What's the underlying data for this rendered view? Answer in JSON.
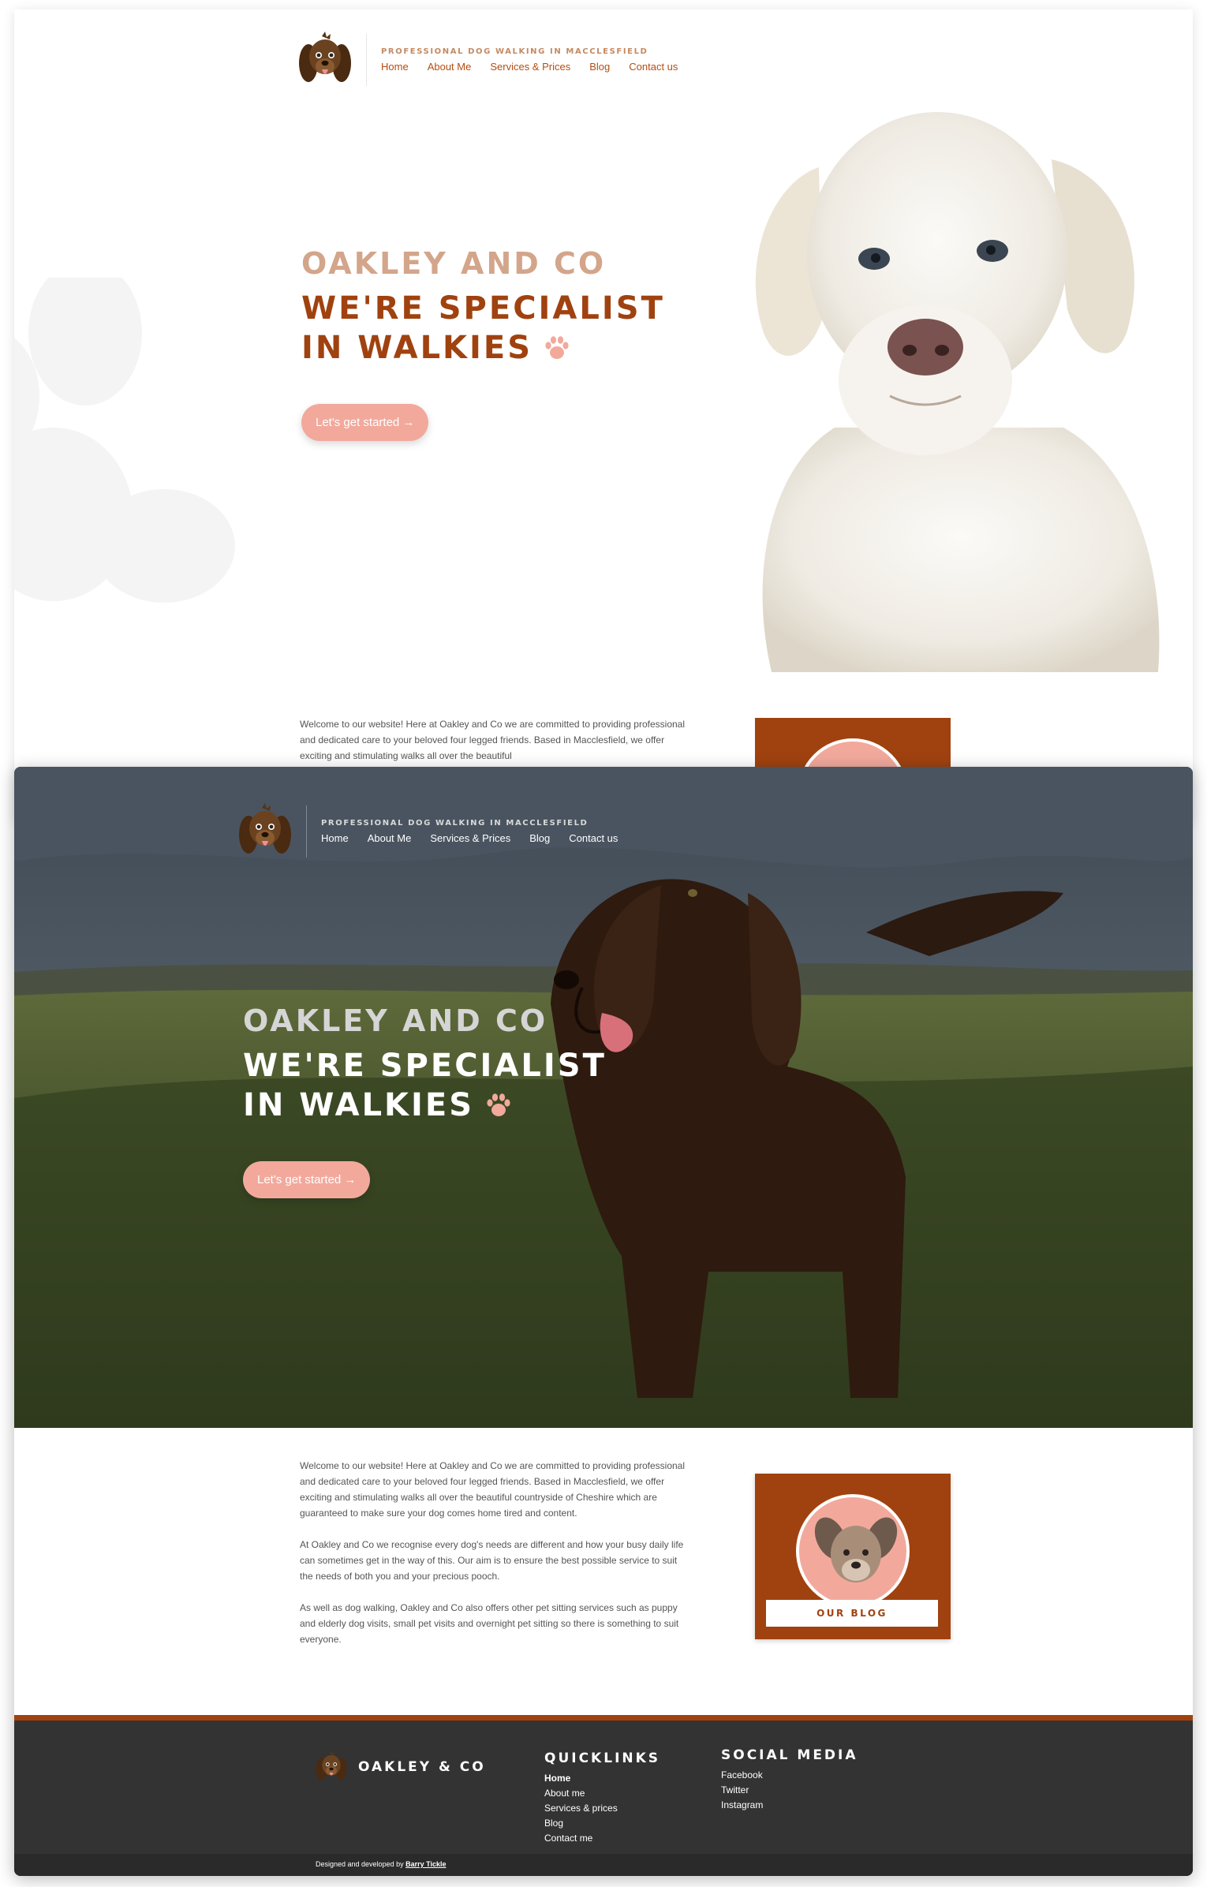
{
  "header": {
    "tagline": "PROFESSIONAL DOG WALKING IN MACCLESFIELD",
    "nav": [
      "Home",
      "About Me",
      "Services & Prices",
      "Blog",
      "Contact us"
    ]
  },
  "hero": {
    "title": "OAKLEY AND CO",
    "subtitle_line1": "WE'RE SPECIALIST",
    "subtitle_line2": "IN WALKIES",
    "cta": "Let's get started →"
  },
  "intro": {
    "paragraph1": "Welcome to our website! Here at Oakley and Co we are committed to providing professional and dedicated care to your beloved four legged friends. Based in Macclesfield, we offer exciting and stimulating walks all over the beautiful countryside of Cheshire which are guaranteed to make sure your dog comes home tired and content.",
    "paragraph1_partial": "Welcome to our website! Here at Oakley and Co we are committed to providing professional and dedicated care to your beloved four legged friends. Based in Macclesfield, we offer exciting and stimulating walks all over the beautiful",
    "paragraph2": "At Oakley and Co we recognise every dog's needs are different and how your busy daily life can sometimes get in the way of this. Our aim is to ensure the best possible service to suit the needs of both you and your precious pooch.",
    "paragraph3": "As well as dog walking, Oakley and Co also offers other pet sitting services such as puppy and elderly dog visits, small pet visits and overnight pet sitting so there is something to suit everyone."
  },
  "blog_card": {
    "button": "OUR BLOG"
  },
  "footer": {
    "brand": "OAKLEY & CO",
    "quicklinks_title": "QUICKLINKS",
    "quicklinks": [
      "Home",
      "About me",
      "Services & prices",
      "Blog",
      "Contact me"
    ],
    "social_title": "SOCIAL MEDIA",
    "social": [
      "Facebook",
      "Twitter",
      "Instagram"
    ],
    "credit_prefix": "Designed and developed by",
    "credit_name": "Barry Tickle"
  },
  "colors": {
    "brand_rust": "#a0420f",
    "salmon": "#f2a99c",
    "tan_title": "#d3a58a",
    "footer_bg": "#333333"
  }
}
